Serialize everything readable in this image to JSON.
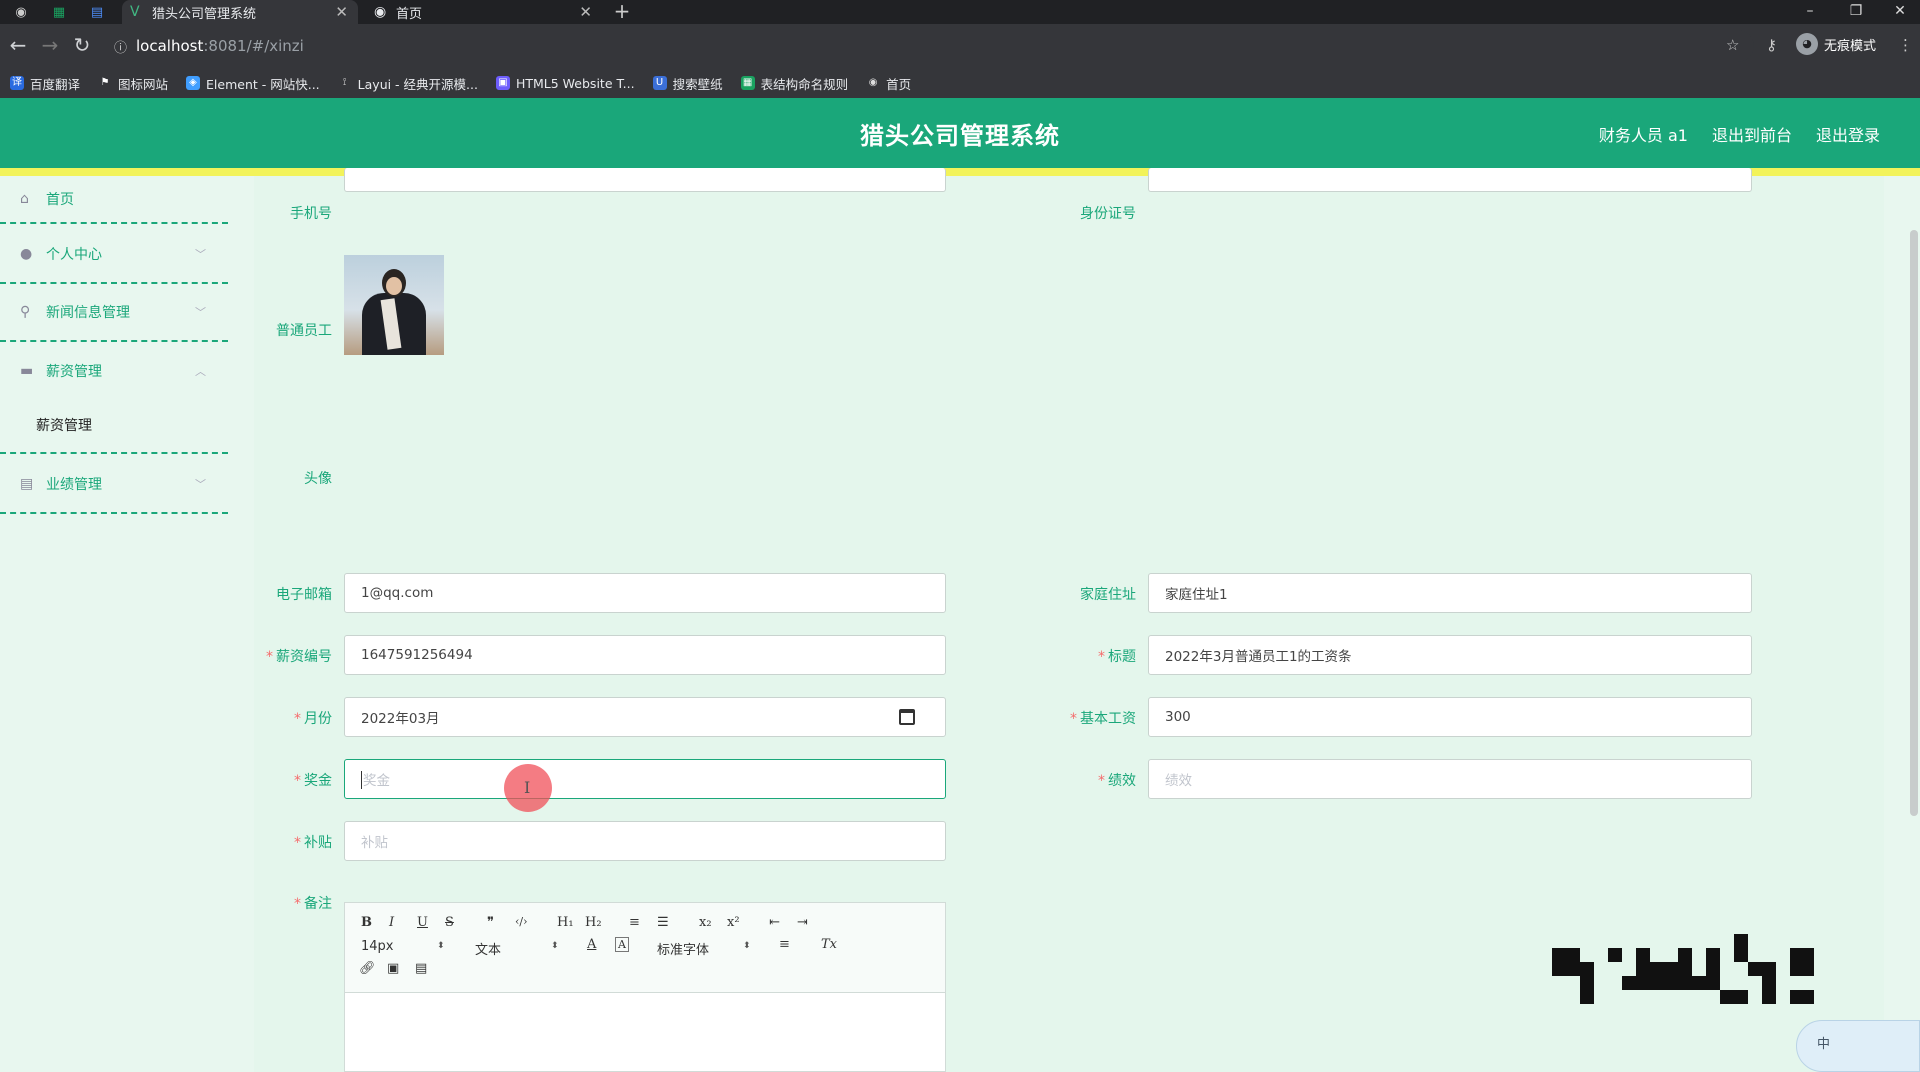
{
  "browser": {
    "tabs": [
      {
        "title": "猎头公司管理系统",
        "active": true
      },
      {
        "title": "首页",
        "active": false
      }
    ],
    "new_tab": "+",
    "url_host": "localhost",
    "url_path": ":8081/#/xinzi",
    "incognito_label": "无痕模式",
    "bookmarks": [
      {
        "label": "百度翻译",
        "icon": "translate-icon",
        "color": "#2a6be0"
      },
      {
        "label": "图标网站",
        "icon": "flag-icon",
        "color": "#444"
      },
      {
        "label": "Element - 网站快...",
        "icon": "element-icon",
        "color": "#409eff"
      },
      {
        "label": "Layui - 经典开源模...",
        "icon": "layui-icon",
        "color": "#555"
      },
      {
        "label": "HTML5 Website T...",
        "icon": "html5-icon",
        "color": "#6d5dfc"
      },
      {
        "label": "搜索壁纸",
        "icon": "wallpaper-icon",
        "color": "#3b6fd8"
      },
      {
        "label": "表结构命名规则",
        "icon": "sheet-icon",
        "color": "#1aa260"
      },
      {
        "label": "首页",
        "icon": "globe-icon",
        "color": "#777"
      }
    ]
  },
  "header": {
    "title": "猎头公司管理系统",
    "user": "财务人员 a1",
    "to_front": "退出到前台",
    "logout": "退出登录"
  },
  "sidebar": {
    "items": [
      {
        "label": "首页",
        "icon": "home-icon"
      },
      {
        "label": "个人中心",
        "icon": "user-icon"
      },
      {
        "label": "新闻信息管理",
        "icon": "microphone-icon"
      },
      {
        "label": "薪资管理",
        "icon": "briefcase-icon"
      },
      {
        "label": "业绩管理",
        "icon": "clipboard-icon"
      }
    ],
    "sub_item": "薪资管理"
  },
  "form": {
    "phone_label": "手机号",
    "idcard_label": "身份证号",
    "employee_label": "普通员工",
    "avatar_label": "头像",
    "email_label": "电子邮箱",
    "email_value": "1@qq.com",
    "address_label": "家庭住址",
    "address_value": "家庭住址1",
    "salary_no_label": "薪资编号",
    "salary_no_value": "1647591256494",
    "title_label": "标题",
    "title_value": "2022年3月普通员工1的工资条",
    "month_label": "月份",
    "month_value": "2022年03月",
    "base_label": "基本工资",
    "base_value": "300",
    "bonus_label": "奖金",
    "bonus_placeholder": "奖金",
    "perf_label": "绩效",
    "perf_placeholder": "绩效",
    "subsidy_label": "补贴",
    "subsidy_placeholder": "补贴",
    "remark_label": "备注",
    "required_mark": "*"
  },
  "editor": {
    "font_size": "14px",
    "block_type": "文本",
    "font_family": "标准字体",
    "buttons_row1": [
      "B",
      "I",
      "U",
      "S",
      "❞",
      "‹/›",
      "H₁",
      "H₂",
      "≡",
      "☰",
      "x₂",
      "x²",
      "⇤",
      "⇥"
    ],
    "color_btn": "A",
    "bg_btn": "A",
    "align_btn": "≡",
    "clear_btn": "Tx"
  },
  "ime": "中",
  "colors": {
    "accent": "#1aa77a",
    "highlight_bar": "#f2f35a",
    "required": "#f56c6c",
    "background": "#e4f6ec"
  }
}
